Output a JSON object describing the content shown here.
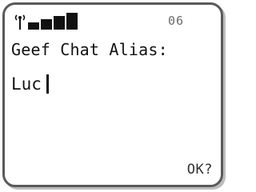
{
  "status_bar": {
    "signal_icon": "signal-strength-icon",
    "signal_level": {
      "filled": 4,
      "total": 4
    },
    "counter": "06"
  },
  "screen": {
    "prompt": "Geef Chat Alias:",
    "input_value": "Luc",
    "cursor_icon": "text-cursor-icon"
  },
  "softkeys": {
    "right_label": "OK?"
  },
  "colors": {
    "frame": "#5a5a5a",
    "text": "#111111",
    "counter_text": "#6b6b6b",
    "background": "#ffffff"
  }
}
